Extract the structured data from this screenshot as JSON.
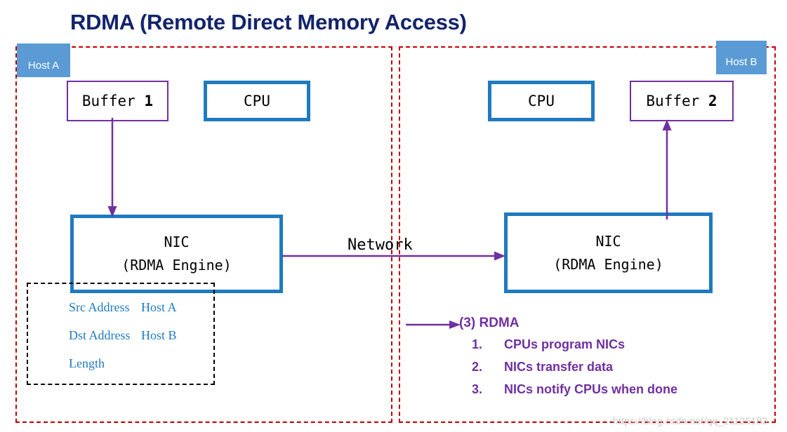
{
  "title": "RDMA (Remote Direct Memory Access)",
  "colors": {
    "title": "#12246b",
    "host_frame_border": "#c00000",
    "host_badge_bg": "#5b9bd5",
    "buffer_border": "#7030a0",
    "nic_border": "#1f7ac0",
    "arrow": "#7030a0",
    "descriptor_text": "#1f7ac0",
    "steps_text": "#7030a0"
  },
  "host_a": {
    "badge_label": "Host A",
    "buffer": {
      "label": "Buffer",
      "number": "1"
    },
    "cpu": {
      "label": "CPU"
    },
    "nic": {
      "line1": "NIC",
      "line2": "(RDMA Engine)"
    },
    "descriptor": {
      "rows": [
        {
          "key": "Src Address",
          "value": "Host A"
        },
        {
          "key": "Dst Address",
          "value": "Host B"
        },
        {
          "key": "Length",
          "value": ""
        }
      ]
    }
  },
  "host_b": {
    "badge_label": "Host B",
    "buffer": {
      "label": "Buffer",
      "number": "2"
    },
    "cpu": {
      "label": "CPU"
    },
    "nic": {
      "line1": "NIC",
      "line2": "(RDMA Engine)"
    }
  },
  "network": {
    "label": "Network"
  },
  "steps": {
    "heading": "(3) RDMA",
    "items": [
      {
        "num": "1.",
        "text": "CPUs program NICs"
      },
      {
        "num": "2.",
        "text": "NICs transfer data"
      },
      {
        "num": "3.",
        "text": "NICs notify CPUs when done"
      }
    ]
  },
  "watermark": "https://blog.csdn.net/qq_21125183"
}
